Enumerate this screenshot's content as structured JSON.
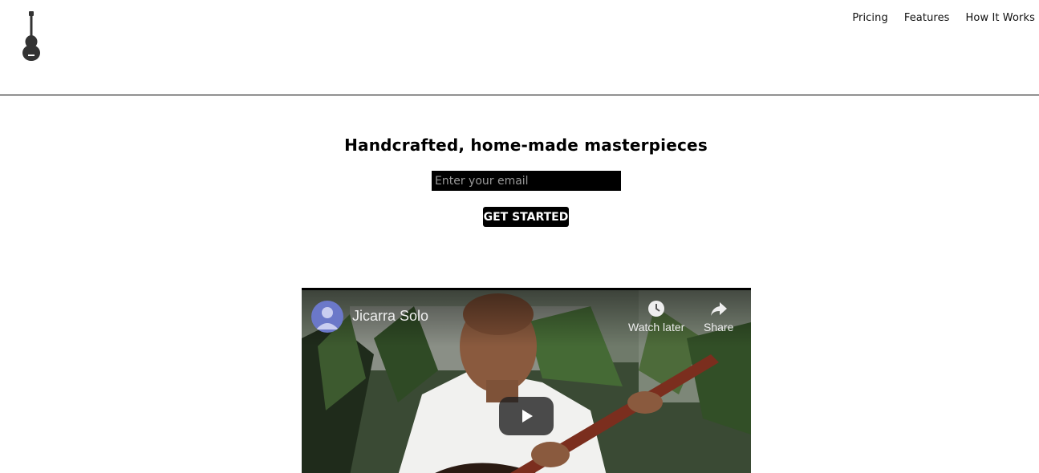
{
  "header": {
    "logo_icon": "ukulele-icon",
    "nav": [
      {
        "label": "Pricing"
      },
      {
        "label": "Features"
      },
      {
        "label": "How It Works"
      }
    ]
  },
  "hero": {
    "title": "Handcrafted, home-made masterpieces",
    "email_placeholder": "Enter your email",
    "cta_label": "GET STARTED"
  },
  "video": {
    "title": "Jicarra Solo",
    "watch_later_label": "Watch later",
    "share_label": "Share",
    "icons": [
      "user-avatar-icon",
      "clock-icon",
      "share-arrow-icon",
      "play-icon"
    ]
  },
  "colors": {
    "text": "#000000",
    "button_bg": "#000000",
    "button_text": "#ffffff",
    "divider": "#000000"
  }
}
